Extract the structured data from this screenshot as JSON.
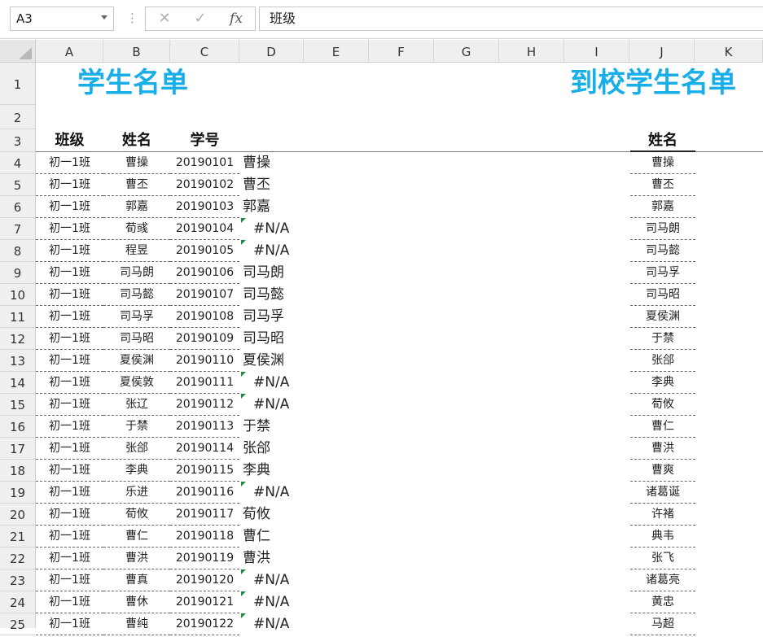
{
  "namebox": {
    "value": "A3"
  },
  "formula_bar": {
    "cancel_glyph": "✕",
    "enter_glyph": "✓",
    "fx_label": "fx",
    "content": "班级"
  },
  "columns": [
    "A",
    "B",
    "C",
    "D",
    "E",
    "F",
    "G",
    "H",
    "I",
    "J",
    "K"
  ],
  "rows": [
    "1",
    "2",
    "3",
    "4",
    "5",
    "6",
    "7",
    "8",
    "9",
    "10",
    "11",
    "12",
    "13",
    "14",
    "15",
    "16",
    "17",
    "18",
    "19",
    "20",
    "21",
    "22",
    "23",
    "24",
    "25"
  ],
  "titles": {
    "left": "学生名单",
    "right": "到校学生名单"
  },
  "headers": {
    "class": "班级",
    "name": "姓名",
    "id": "学号",
    "j_name": "姓名"
  },
  "na_marker_color": "#1e8a3c",
  "title_color": "#18aee8",
  "students": [
    {
      "class": "初一1班",
      "name": "曹操",
      "id": "20190101",
      "lookup": "曹操"
    },
    {
      "class": "初一1班",
      "name": "曹丕",
      "id": "20190102",
      "lookup": "曹丕"
    },
    {
      "class": "初一1班",
      "name": "郭嘉",
      "id": "20190103",
      "lookup": "郭嘉"
    },
    {
      "class": "初一1班",
      "name": "荀彧",
      "id": "20190104",
      "lookup": "#N/A"
    },
    {
      "class": "初一1班",
      "name": "程昱",
      "id": "20190105",
      "lookup": "#N/A"
    },
    {
      "class": "初一1班",
      "name": "司马朗",
      "id": "20190106",
      "lookup": "司马朗"
    },
    {
      "class": "初一1班",
      "name": "司马懿",
      "id": "20190107",
      "lookup": "司马懿"
    },
    {
      "class": "初一1班",
      "name": "司马孚",
      "id": "20190108",
      "lookup": "司马孚"
    },
    {
      "class": "初一1班",
      "name": "司马昭",
      "id": "20190109",
      "lookup": "司马昭"
    },
    {
      "class": "初一1班",
      "name": "夏侯渊",
      "id": "20190110",
      "lookup": "夏侯渊"
    },
    {
      "class": "初一1班",
      "name": "夏侯敦",
      "id": "20190111",
      "lookup": "#N/A"
    },
    {
      "class": "初一1班",
      "name": "张辽",
      "id": "20190112",
      "lookup": "#N/A"
    },
    {
      "class": "初一1班",
      "name": "于禁",
      "id": "20190113",
      "lookup": "于禁"
    },
    {
      "class": "初一1班",
      "name": "张郃",
      "id": "20190114",
      "lookup": "张郃"
    },
    {
      "class": "初一1班",
      "name": "李典",
      "id": "20190115",
      "lookup": "李典"
    },
    {
      "class": "初一1班",
      "name": "乐进",
      "id": "20190116",
      "lookup": "#N/A"
    },
    {
      "class": "初一1班",
      "name": "荀攸",
      "id": "20190117",
      "lookup": "荀攸"
    },
    {
      "class": "初一1班",
      "name": "曹仁",
      "id": "20190118",
      "lookup": "曹仁"
    },
    {
      "class": "初一1班",
      "name": "曹洪",
      "id": "20190119",
      "lookup": "曹洪"
    },
    {
      "class": "初一1班",
      "name": "曹真",
      "id": "20190120",
      "lookup": "#N/A"
    },
    {
      "class": "初一1班",
      "name": "曹休",
      "id": "20190121",
      "lookup": "#N/A"
    },
    {
      "class": "初一1班",
      "name": "曹纯",
      "id": "20190122",
      "lookup": "#N/A"
    }
  ],
  "arrived": [
    "曹操",
    "曹丕",
    "郭嘉",
    "司马朗",
    "司马懿",
    "司马孚",
    "司马昭",
    "夏侯渊",
    "于禁",
    "张郃",
    "李典",
    "荀攸",
    "曹仁",
    "曹洪",
    "曹爽",
    "诸葛诞",
    "许褚",
    "典韦",
    "张飞",
    "诸葛亮",
    "黄忠",
    "马超"
  ]
}
